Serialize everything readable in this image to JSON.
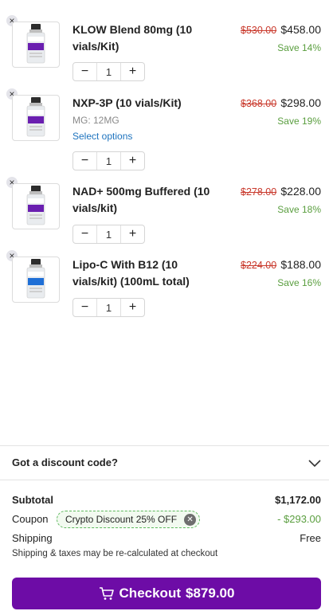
{
  "cart": {
    "items": [
      {
        "name": "KLOW Blend 80mg (10 vials/Kit)",
        "old_price": "$530.00",
        "price": "$458.00",
        "save": "Save 14%",
        "quantity": "1",
        "label_color": "#6a1fb0",
        "remove_icon": "close-icon"
      },
      {
        "name": "NXP-3P (10 vials/Kit)",
        "meta": "MG: 12MG",
        "link": "Select options",
        "old_price": "$368.00",
        "price": "$298.00",
        "save": "Save 19%",
        "quantity": "1",
        "label_color": "#6a1fb0",
        "remove_icon": "close-icon"
      },
      {
        "name": "NAD+ 500mg Buffered (10 vials/kit)",
        "old_price": "$278.00",
        "price": "$228.00",
        "save": "Save 18%",
        "quantity": "1",
        "label_color": "#6a1fb0",
        "remove_icon": "close-icon"
      },
      {
        "name": "Lipo-C With B12 (10 vials/kit) (100mL total)",
        "old_price": "$224.00",
        "price": "$188.00",
        "save": "Save 16%",
        "quantity": "1",
        "label_color": "#1f6fd6",
        "remove_icon": "close-icon"
      }
    ],
    "qty_minus": "−",
    "qty_plus": "+"
  },
  "discount": {
    "label": "Got a discount code?",
    "icon": "chevron-down-icon"
  },
  "totals": {
    "subtotal_label": "Subtotal",
    "subtotal_value": "$1,172.00",
    "coupon_label": "Coupon",
    "coupon_code": "Crypto Discount 25% OFF",
    "coupon_value": "-  $293.00",
    "shipping_label": "Shipping",
    "shipping_value": "Free",
    "note": "Shipping & taxes may be re-calculated at checkout"
  },
  "checkout": {
    "label": "Checkout",
    "amount": "$879.00",
    "icon": "cart-icon"
  },
  "colors": {
    "accent": "#6d0ca6",
    "sale_red": "#c9392c",
    "save_green": "#5a9e3f"
  }
}
